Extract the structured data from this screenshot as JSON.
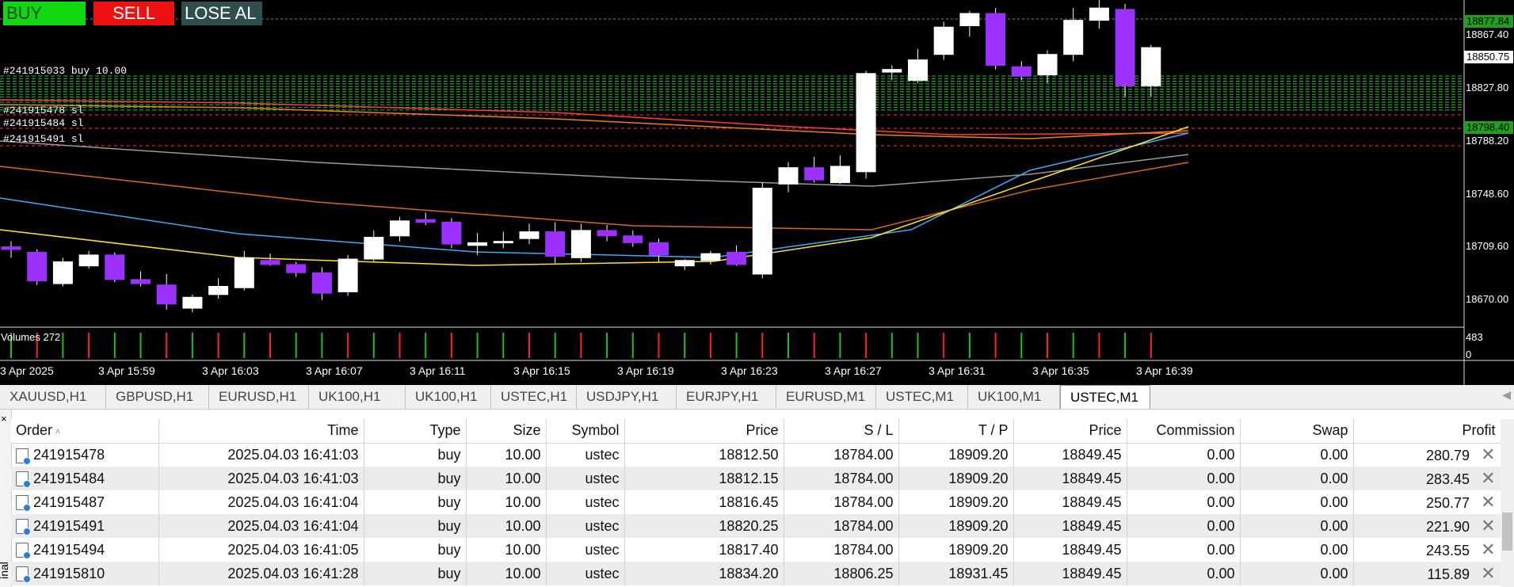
{
  "toolbar": {
    "buy_label": "BUY",
    "sell_label": "SELL",
    "close_all_label": "LOSE AL"
  },
  "position_labels": [
    "#241915033 buy 10.00",
    "#241915478 sl",
    "#241915484 sl",
    "#241915491 sl"
  ],
  "price_axis": [
    "18867.40",
    "18827.80",
    "18788.20",
    "18748.60",
    "18709.60",
    "18670.00"
  ],
  "price_tags": [
    {
      "label": "18877.84",
      "style": "green"
    },
    {
      "label": "18850.75",
      "style": "white"
    },
    {
      "label": "18798.40",
      "style": "green"
    }
  ],
  "time_axis": [
    "3 Apr 2025",
    "3 Apr 15:59",
    "3 Apr 16:03",
    "3 Apr 16:07",
    "3 Apr 16:11",
    "3 Apr 16:15",
    "3 Apr 16:19",
    "3 Apr 16:23",
    "3 Apr 16:27",
    "3 Apr 16:31",
    "3 Apr 16:35",
    "3 Apr 16:39"
  ],
  "volumes": {
    "label": "Volumes 272",
    "max": "483",
    "min": "0"
  },
  "colors": {
    "bull": "#ffffff",
    "bear": "#9b30ff",
    "buy_btn": "#11d711",
    "sell_btn": "#ee1111",
    "close_btn": "#2f4f4f"
  },
  "candles": [
    {
      "o": 18708,
      "h": 18712,
      "l": 18700,
      "c": 18706
    },
    {
      "o": 18704,
      "h": 18706,
      "l": 18680,
      "c": 18683
    },
    {
      "o": 18681,
      "h": 18700,
      "l": 18679,
      "c": 18697
    },
    {
      "o": 18694,
      "h": 18705,
      "l": 18692,
      "c": 18702
    },
    {
      "o": 18702,
      "h": 18704,
      "l": 18682,
      "c": 18684
    },
    {
      "o": 18684,
      "h": 18690,
      "l": 18679,
      "c": 18681
    },
    {
      "o": 18680,
      "h": 18688,
      "l": 18662,
      "c": 18666
    },
    {
      "o": 18663,
      "h": 18673,
      "l": 18660,
      "c": 18671
    },
    {
      "o": 18673,
      "h": 18685,
      "l": 18670,
      "c": 18679
    },
    {
      "o": 18678,
      "h": 18705,
      "l": 18676,
      "c": 18700
    },
    {
      "o": 18698,
      "h": 18703,
      "l": 18694,
      "c": 18695
    },
    {
      "o": 18695,
      "h": 18697,
      "l": 18686,
      "c": 18689
    },
    {
      "o": 18689,
      "h": 18693,
      "l": 18669,
      "c": 18674
    },
    {
      "o": 18675,
      "h": 18702,
      "l": 18672,
      "c": 18699
    },
    {
      "o": 18699,
      "h": 18720,
      "l": 18697,
      "c": 18715
    },
    {
      "o": 18716,
      "h": 18730,
      "l": 18712,
      "c": 18727
    },
    {
      "o": 18728,
      "h": 18733,
      "l": 18724,
      "c": 18726
    },
    {
      "o": 18726,
      "h": 18729,
      "l": 18707,
      "c": 18710
    },
    {
      "o": 18709,
      "h": 18718,
      "l": 18702,
      "c": 18711
    },
    {
      "o": 18711,
      "h": 18719,
      "l": 18707,
      "c": 18712
    },
    {
      "o": 18714,
      "h": 18725,
      "l": 18710,
      "c": 18719
    },
    {
      "o": 18719,
      "h": 18726,
      "l": 18696,
      "c": 18701
    },
    {
      "o": 18700,
      "h": 18725,
      "l": 18697,
      "c": 18720
    },
    {
      "o": 18720,
      "h": 18724,
      "l": 18712,
      "c": 18716
    },
    {
      "o": 18716,
      "h": 18720,
      "l": 18708,
      "c": 18711
    },
    {
      "o": 18711,
      "h": 18714,
      "l": 18697,
      "c": 18702
    },
    {
      "o": 18694,
      "h": 18699,
      "l": 18691,
      "c": 18698
    },
    {
      "o": 18698,
      "h": 18705,
      "l": 18695,
      "c": 18703
    },
    {
      "o": 18704,
      "h": 18709,
      "l": 18694,
      "c": 18695
    },
    {
      "o": 18688,
      "h": 18755,
      "l": 18685,
      "c": 18751
    },
    {
      "o": 18754,
      "h": 18770,
      "l": 18748,
      "c": 18766
    },
    {
      "o": 18766,
      "h": 18774,
      "l": 18755,
      "c": 18757
    },
    {
      "o": 18755,
      "h": 18775,
      "l": 18754,
      "c": 18767
    },
    {
      "o": 18763,
      "h": 18837,
      "l": 18758,
      "c": 18835
    },
    {
      "o": 18836,
      "h": 18841,
      "l": 18830,
      "c": 18838
    },
    {
      "o": 18830,
      "h": 18853,
      "l": 18828,
      "c": 18845
    },
    {
      "o": 18849,
      "h": 18873,
      "l": 18845,
      "c": 18869
    },
    {
      "o": 18870,
      "h": 18881,
      "l": 18862,
      "c": 18879
    },
    {
      "o": 18879,
      "h": 18883,
      "l": 18838,
      "c": 18841
    },
    {
      "o": 18840,
      "h": 18844,
      "l": 18830,
      "c": 18833
    },
    {
      "o": 18834,
      "h": 18852,
      "l": 18828,
      "c": 18849
    },
    {
      "o": 18849,
      "h": 18883,
      "l": 18844,
      "c": 18874
    },
    {
      "o": 18874,
      "h": 18895,
      "l": 18868,
      "c": 18883
    },
    {
      "o": 18882,
      "h": 18886,
      "l": 18818,
      "c": 18826
    },
    {
      "o": 18826,
      "h": 18856,
      "l": 18818,
      "c": 18854
    }
  ],
  "volume_bars": [
    "g",
    "r",
    "g",
    "r",
    "g",
    "g",
    "r",
    "g",
    "r",
    "g",
    "r",
    "g",
    "g",
    "r",
    "g",
    "r",
    "g",
    "r",
    "g",
    "g",
    "r",
    "g",
    "r",
    "g",
    "g",
    "r",
    "g",
    "r",
    "g",
    "r",
    "g",
    "r",
    "g",
    "r",
    "g",
    "g",
    "r",
    "g",
    "r",
    "g",
    "r",
    "g",
    "r",
    "g",
    "r"
  ],
  "tabs": [
    "XAUUSD,H1",
    "GBPUSD,H1",
    "EURUSD,H1",
    "UK100,H1",
    "UK100,H1",
    "USTEC,H1",
    "USDJPY,H1",
    "EURJPY,H1",
    "EURUSD,M1",
    "USTEC,M1",
    "UK100,M1",
    "USTEC,M1"
  ],
  "active_tab": 11,
  "terminal": {
    "close_glyph": "×",
    "side_label": "inal"
  },
  "columns": [
    "Order",
    "Time",
    "Type",
    "Size",
    "Symbol",
    "Price",
    "S / L",
    "T / P",
    "Price",
    "Commission",
    "Swap",
    "Profit"
  ],
  "orders": [
    {
      "order": "241915478",
      "time": "2025.04.03 16:41:03",
      "type": "buy",
      "size": "10.00",
      "symbol": "ustec",
      "price": "18812.50",
      "sl": "18784.00",
      "tp": "18909.20",
      "cur": "18849.45",
      "commission": "0.00",
      "swap": "0.00",
      "profit": "280.79"
    },
    {
      "order": "241915484",
      "time": "2025.04.03 16:41:03",
      "type": "buy",
      "size": "10.00",
      "symbol": "ustec",
      "price": "18812.15",
      "sl": "18784.00",
      "tp": "18909.20",
      "cur": "18849.45",
      "commission": "0.00",
      "swap": "0.00",
      "profit": "283.45"
    },
    {
      "order": "241915487",
      "time": "2025.04.03 16:41:04",
      "type": "buy",
      "size": "10.00",
      "symbol": "ustec",
      "price": "18816.45",
      "sl": "18784.00",
      "tp": "18909.20",
      "cur": "18849.45",
      "commission": "0.00",
      "swap": "0.00",
      "profit": "250.77"
    },
    {
      "order": "241915491",
      "time": "2025.04.03 16:41:04",
      "type": "buy",
      "size": "10.00",
      "symbol": "ustec",
      "price": "18820.25",
      "sl": "18784.00",
      "tp": "18909.20",
      "cur": "18849.45",
      "commission": "0.00",
      "swap": "0.00",
      "profit": "221.90"
    },
    {
      "order": "241915494",
      "time": "2025.04.03 16:41:05",
      "type": "buy",
      "size": "10.00",
      "symbol": "ustec",
      "price": "18817.40",
      "sl": "18784.00",
      "tp": "18909.20",
      "cur": "18849.45",
      "commission": "0.00",
      "swap": "0.00",
      "profit": "243.55"
    },
    {
      "order": "241915810",
      "time": "2025.04.03 16:41:28",
      "type": "buy",
      "size": "10.00",
      "symbol": "ustec",
      "price": "18834.20",
      "sl": "18806.25",
      "tp": "18931.45",
      "cur": "18849.45",
      "commission": "0.00",
      "swap": "0.00",
      "profit": "115.89"
    }
  ]
}
